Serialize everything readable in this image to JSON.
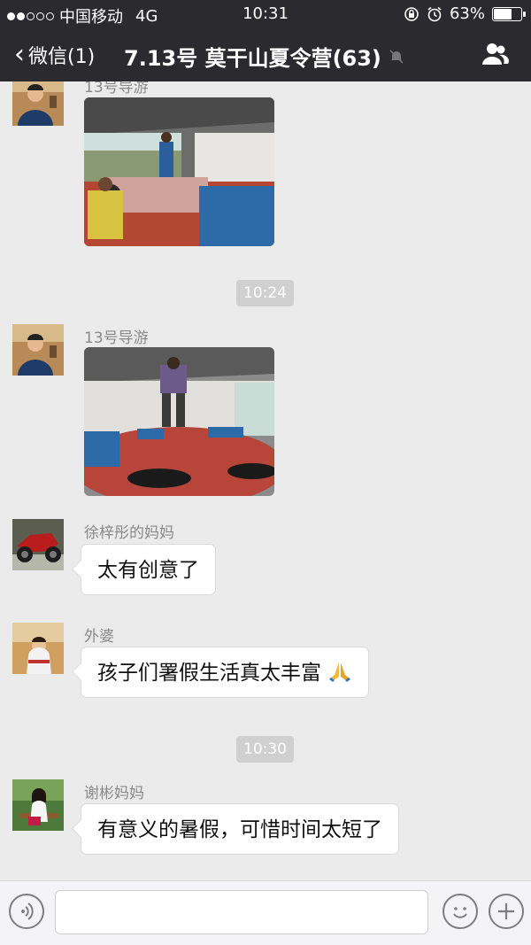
{
  "status_bar": {
    "carrier": "中国移动",
    "network": "4G",
    "time": "10:31",
    "battery": "63%",
    "battery_level": 0.63
  },
  "nav": {
    "back_label": "微信(1)",
    "title": "7.13号 莫干山夏令营(63)"
  },
  "messages": [
    {
      "type": "image",
      "sender": "13号导游"
    },
    {
      "type": "time",
      "text": "10:24"
    },
    {
      "type": "image",
      "sender": "13号导游"
    },
    {
      "type": "text",
      "sender": "徐梓彤的妈妈",
      "text": "太有创意了"
    },
    {
      "type": "text",
      "sender": "外婆",
      "text": "孩子们署假生活真太丰富",
      "emoji": "folded-hands"
    },
    {
      "type": "time",
      "text": "10:30"
    },
    {
      "type": "text",
      "sender": "谢彬妈妈",
      "text": "有意义的暑假，可惜时间太短了"
    }
  ],
  "input": {
    "value": "",
    "placeholder": ""
  },
  "colors": {
    "bar": "#2b2b2f",
    "chat_bg": "#ebebeb",
    "time_pill": "#d0d0d0"
  }
}
